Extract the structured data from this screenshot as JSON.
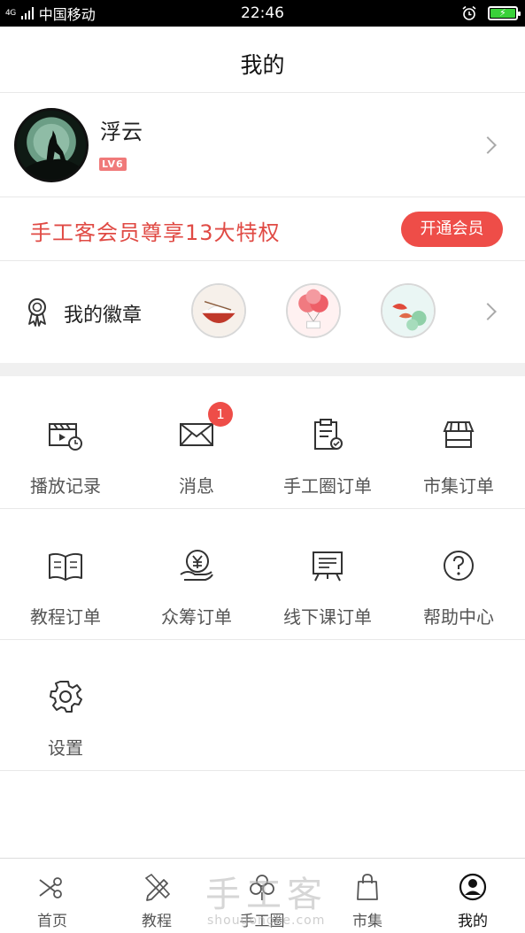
{
  "status_bar": {
    "network": "4G",
    "carrier": "中国移动",
    "time": "22:46"
  },
  "header": {
    "title": "我的"
  },
  "profile": {
    "name": "浮云",
    "level": "LV6"
  },
  "vip": {
    "text": "手工客会员尊享13大特权",
    "button": "开通会员"
  },
  "badges": {
    "label": "我的徽章"
  },
  "menu": {
    "row1": [
      {
        "label": "播放记录",
        "icon": "play-history-icon"
      },
      {
        "label": "消息",
        "icon": "mail-icon",
        "badge": "1"
      },
      {
        "label": "手工圈订单",
        "icon": "clipboard-icon"
      },
      {
        "label": "市集订单",
        "icon": "store-icon"
      }
    ],
    "row2": [
      {
        "label": "教程订单",
        "icon": "book-icon"
      },
      {
        "label": "众筹订单",
        "icon": "yuan-hand-icon"
      },
      {
        "label": "线下课订单",
        "icon": "board-icon"
      },
      {
        "label": "帮助中心",
        "icon": "question-icon"
      }
    ],
    "row3": [
      {
        "label": "设置",
        "icon": "gear-icon"
      }
    ]
  },
  "watermark": {
    "big": "手工客",
    "small": "shougongke.com"
  },
  "tabbar": [
    {
      "label": "首页",
      "icon": "scissors-icon"
    },
    {
      "label": "教程",
      "icon": "pencil-ruler-icon"
    },
    {
      "label": "手工圈",
      "icon": "flower-icon"
    },
    {
      "label": "市集",
      "icon": "shopping-bag-icon"
    },
    {
      "label": "我的",
      "icon": "user-circle-icon",
      "active": true
    }
  ],
  "colors": {
    "accent": "#ee4d48",
    "vip_text": "#e04a44",
    "divider": "#e8e8e8"
  }
}
